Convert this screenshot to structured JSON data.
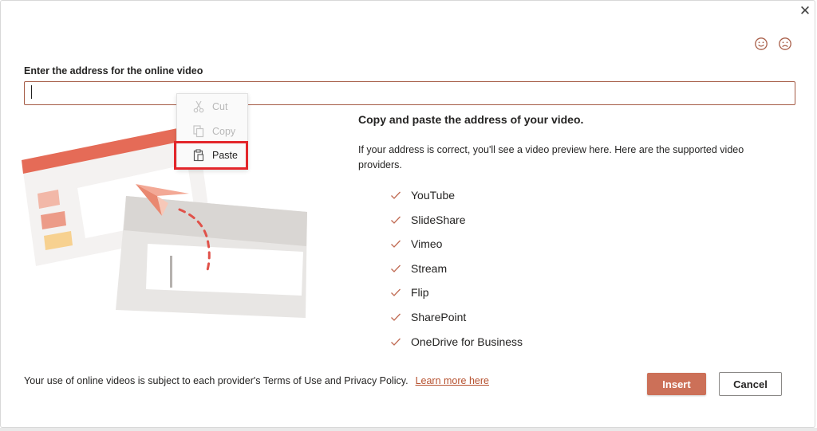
{
  "dialog": {
    "close_glyph": "✕",
    "feedback": {
      "smile_icon": "smile-icon",
      "frown_icon": "frown-icon"
    }
  },
  "input": {
    "label": "Enter the address for the online video",
    "value": "",
    "placeholder": ""
  },
  "context_menu": {
    "items": [
      {
        "label": "Cut",
        "icon": "scissors-icon",
        "enabled": false
      },
      {
        "label": "Copy",
        "icon": "copy-icon",
        "enabled": false
      },
      {
        "label": "Paste",
        "icon": "clipboard-icon",
        "enabled": true,
        "highlighted": true
      }
    ]
  },
  "info": {
    "heading": "Copy and paste the address of your video.",
    "description": "If your address is correct, you'll see a video preview here. Here are the supported video providers.",
    "providers": [
      "YouTube",
      "SlideShare",
      "Vimeo",
      "Stream",
      "Flip",
      "SharePoint",
      "OneDrive for Business"
    ]
  },
  "footer": {
    "terms_text": "Your use of online videos is subject to each provider's Terms of Use and Privacy Policy.",
    "learn_more": "Learn more here",
    "insert_label": "Insert",
    "cancel_label": "Cancel"
  },
  "colors": {
    "accent": "#cc7058",
    "input_border": "#a45a44",
    "link": "#b6512f",
    "highlight": "#e3262b"
  }
}
